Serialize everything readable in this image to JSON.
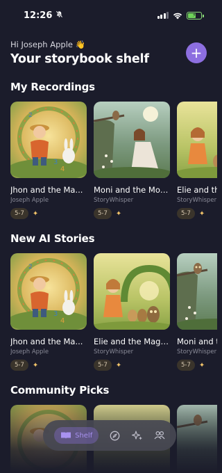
{
  "status": {
    "time": "12:26"
  },
  "header": {
    "greeting": "Hi Joseph Apple 👋",
    "title": "Your storybook shelf",
    "add_label": "+"
  },
  "sections": [
    {
      "title": "My Recordings",
      "cards": [
        {
          "title": "Jhon and the Ma...",
          "author": "Joseph Apple",
          "age": "5-7",
          "sparkle": "✦"
        },
        {
          "title": "Moni and the Moo...",
          "author": "StoryWhisper",
          "age": "5-7",
          "sparkle": "✦"
        },
        {
          "title": "Elie and the Magi...",
          "author": "StoryWhisper",
          "age": "5-7",
          "sparkle": "✦"
        }
      ]
    },
    {
      "title": "New AI Stories",
      "cards": [
        {
          "title": "Jhon and the Ma...",
          "author": "Joseph Apple",
          "age": "5-7",
          "sparkle": "✦"
        },
        {
          "title": "Elie and the Magi...",
          "author": "StoryWhisper",
          "age": "5-7",
          "sparkle": "✦"
        },
        {
          "title": "Moni and the Moo...",
          "author": "StoryWhisper",
          "age": "5-7",
          "sparkle": "✦"
        }
      ]
    },
    {
      "title": "Community Picks"
    }
  ],
  "tab_bar": {
    "shelf_label": "Shelf"
  }
}
